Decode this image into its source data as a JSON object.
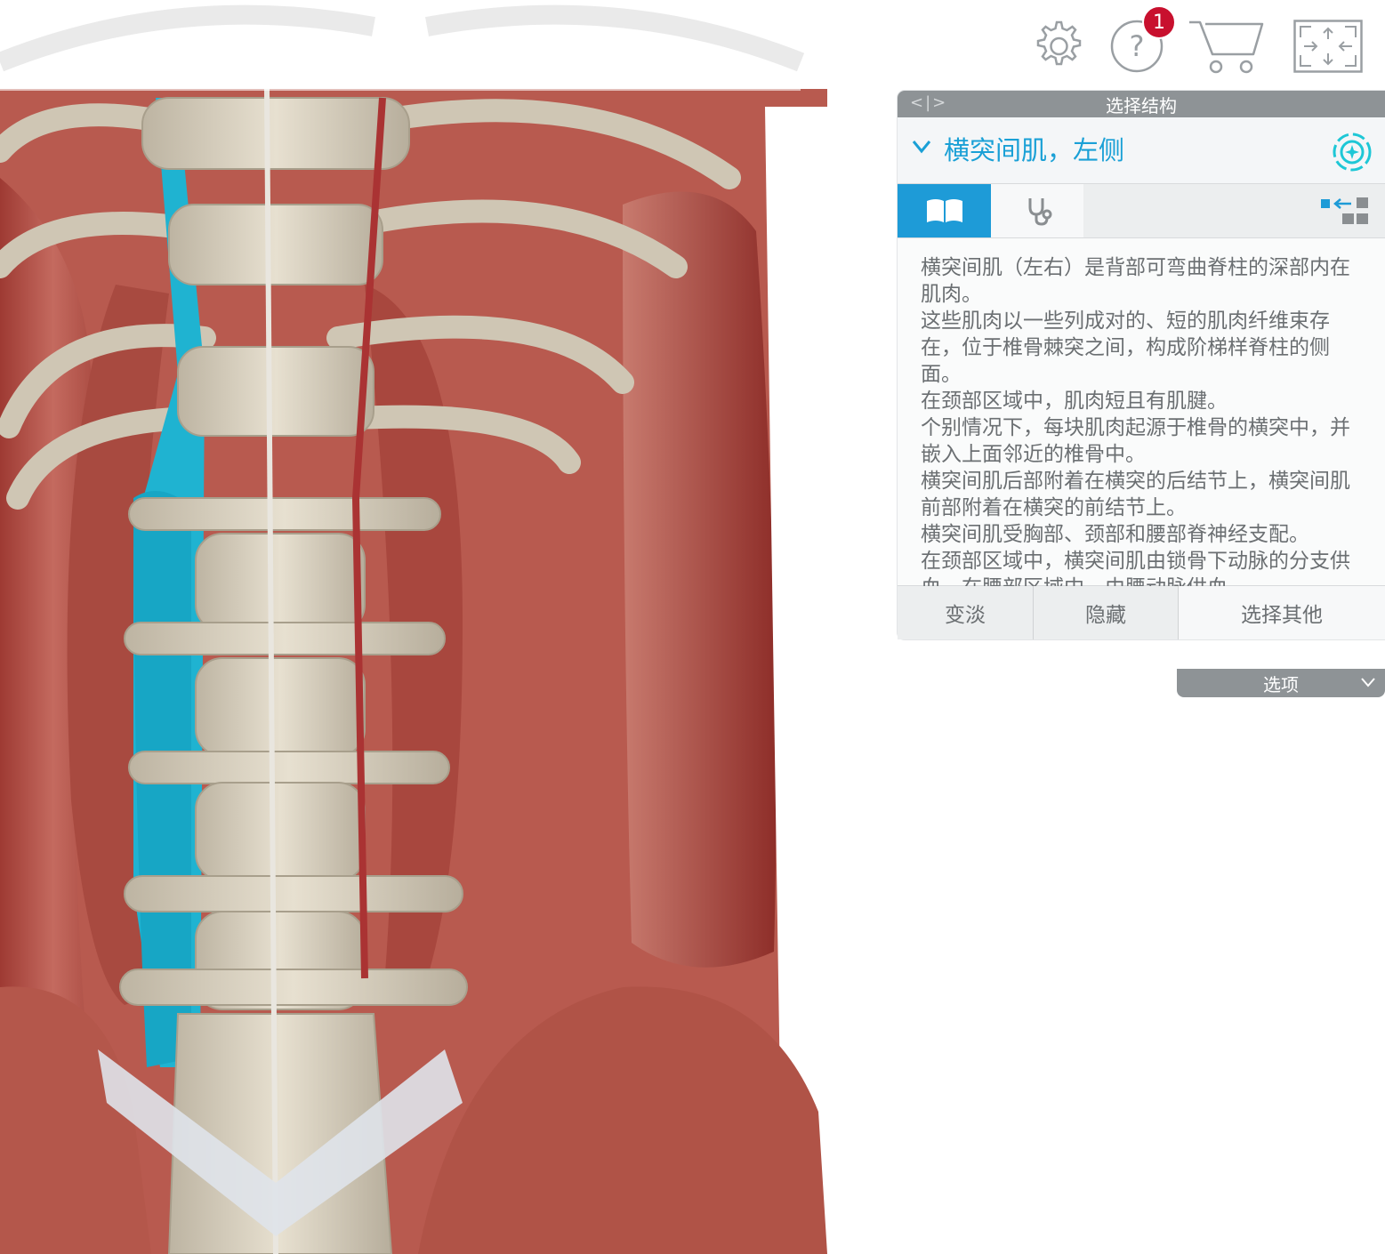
{
  "toolbar": {
    "settings_icon": "gear-icon",
    "help_icon": "question-circle-icon",
    "help_badge": "1",
    "cart_icon": "cart-icon",
    "fullscreen_icon": "fullscreen-icon"
  },
  "panel": {
    "title": "选择结构",
    "structure_name": "横突间肌，左侧",
    "tabs": [
      {
        "icon": "book-icon",
        "active": true
      },
      {
        "icon": "stethoscope-icon",
        "active": false
      }
    ],
    "description": [
      "横突间肌（左右）是背部可弯曲脊柱的深部内在肌肉。",
      "这些肌肉以一些列成对的、短的肌肉纤维束存在，位于椎骨棘突之间，构成阶梯样脊柱的侧面。",
      "在颈部区域中，肌肉短且有肌腱。",
      "个别情况下，每块肌肉起源于椎骨的横突中，并嵌入上面邻近的椎骨中。",
      "横突间肌后部附着在横突的后结节上，横突间肌前部附着在横突的前结节上。",
      "横突间肌受胸部、颈部和腰部脊神经支配。",
      "在颈部区域中，横突间肌由锁骨下动脉的分支供血，在腰部区域中，由腰动脉供血。"
    ],
    "actions": {
      "fade": "变淡",
      "hide": "隐藏",
      "select_other": "选择其他"
    },
    "options_label": "选项"
  },
  "colors": {
    "accent": "#1e9bd7",
    "highlight_muscle": "#1fb3d1",
    "muscle": "#b0463f",
    "bone": "#d8d0bf",
    "badge": "#c8102e"
  }
}
